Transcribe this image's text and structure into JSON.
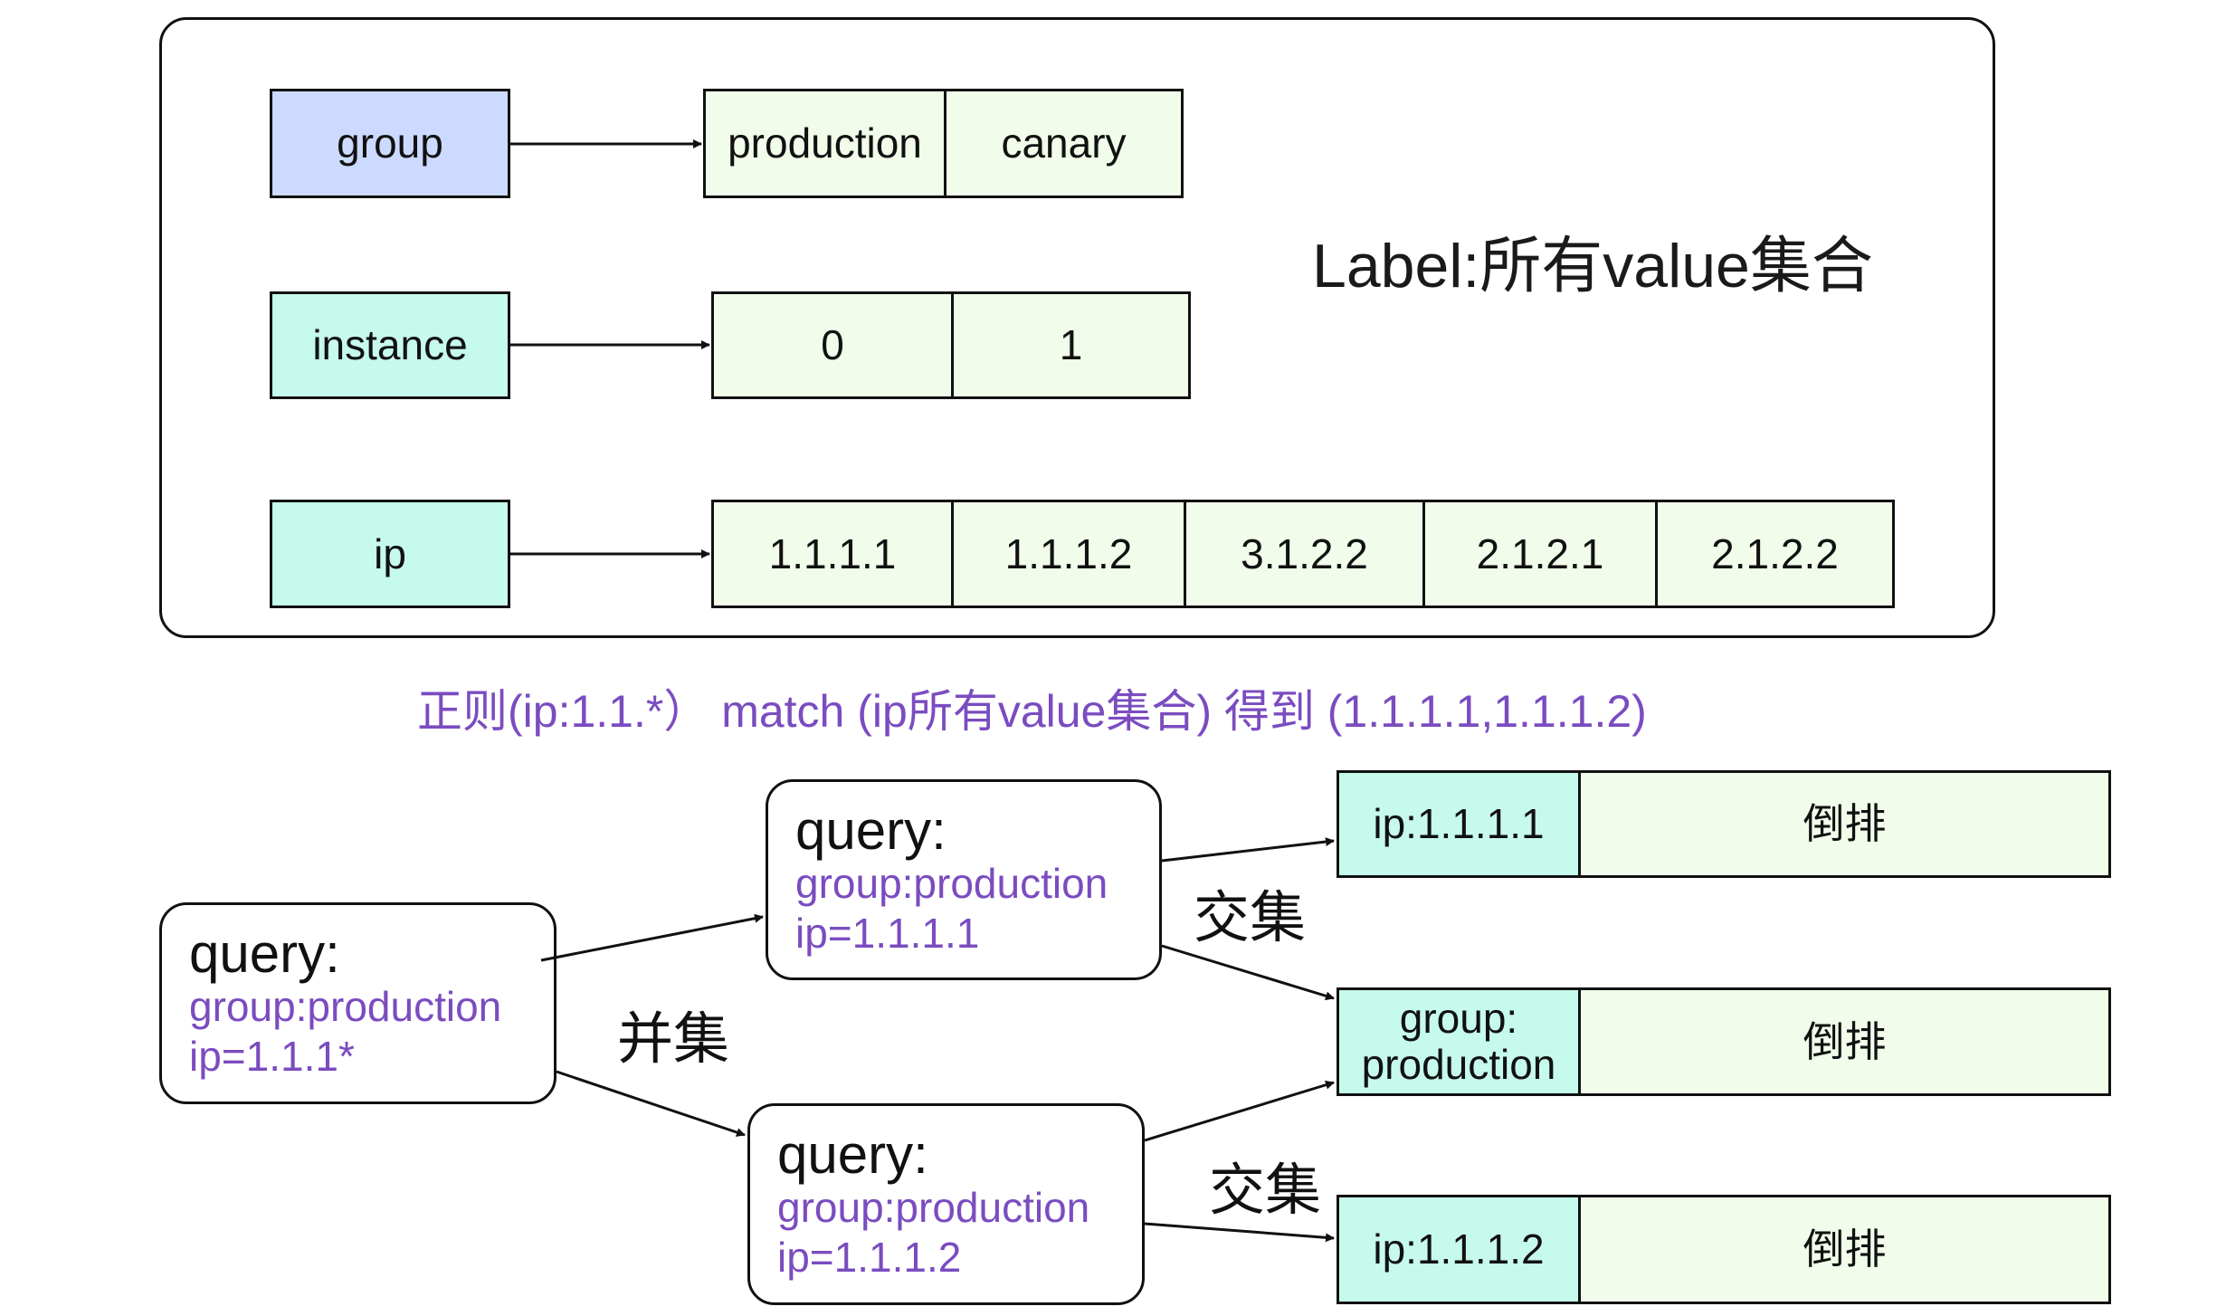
{
  "label_panel": {
    "title": "Label:所有value集合",
    "rows": [
      {
        "key": "group",
        "values": [
          "production",
          "canary"
        ]
      },
      {
        "key": "instance",
        "values": [
          "0",
          "1"
        ]
      },
      {
        "key": "ip",
        "values": [
          "1.1.1.1",
          "1.1.1.2",
          "3.1.2.2",
          "2.1.2.1",
          "2.1.2.2"
        ]
      }
    ]
  },
  "regex_note": "正则(ip:1.1.*）  match (ip所有value集合) 得到 (1.1.1.1,1.1.1.2)",
  "queries": {
    "root": {
      "title": "query:",
      "lines": [
        "group:production",
        "ip=1.1.1*"
      ]
    },
    "sub1": {
      "title": "query:",
      "lines": [
        "group:production",
        "ip=1.1.1.1"
      ]
    },
    "sub2": {
      "title": "query:",
      "lines": [
        "group:production",
        "ip=1.1.1.2"
      ]
    }
  },
  "set_ops": {
    "union": "并集",
    "intersect1": "交集",
    "intersect2": "交集"
  },
  "postings": [
    {
      "key": "ip:1.1.1.1",
      "value": "倒排"
    },
    {
      "key": "group:\nproduction",
      "key_line1": "group:",
      "key_line2": "production",
      "value": "倒排"
    },
    {
      "key": "ip:1.1.1.2",
      "value": "倒排"
    }
  ],
  "colors": {
    "key_group": "#ccdaff",
    "key_other": "#c6faec",
    "value_cell": "#f1fdea",
    "accent_text": "#7a4cc0"
  }
}
